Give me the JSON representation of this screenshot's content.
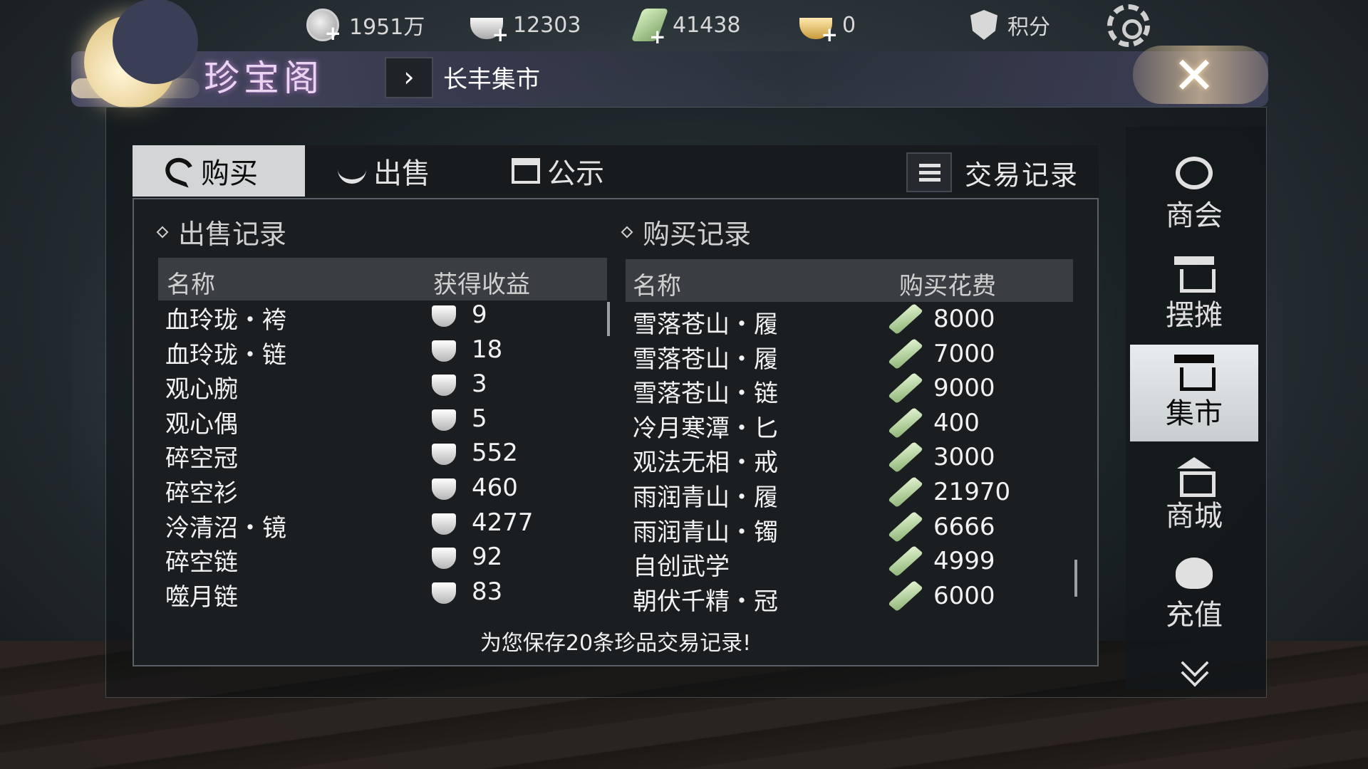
{
  "resources": [
    {
      "icon": "silver-coin-icon",
      "value": "1951万"
    },
    {
      "icon": "silver-ingot-icon",
      "value": "12303"
    },
    {
      "icon": "jade-icon",
      "value": "41438"
    },
    {
      "icon": "gold-ingot-icon",
      "value": "0"
    }
  ],
  "points_label": "积分",
  "title": "珍宝阁",
  "breadcrumb": "长丰集市",
  "tabs": [
    {
      "label": "购买",
      "active": true
    },
    {
      "label": "出售",
      "active": false
    },
    {
      "label": "公示",
      "active": false
    }
  ],
  "trade_record_label": "交易记录",
  "sell_records": {
    "title": "出售记录",
    "col_name": "名称",
    "col_value": "获得收益",
    "currency_icon": "silver-ingot-icon",
    "rows": [
      {
        "name": "血玲珑・袴",
        "value": "9"
      },
      {
        "name": "血玲珑・链",
        "value": "18"
      },
      {
        "name": "观心腕",
        "value": "3"
      },
      {
        "name": "观心偶",
        "value": "5"
      },
      {
        "name": "碎空冠",
        "value": "552"
      },
      {
        "name": "碎空衫",
        "value": "460"
      },
      {
        "name": "泠清沼・镜",
        "value": "4277"
      },
      {
        "name": "碎空链",
        "value": "92"
      },
      {
        "name": "噬月链",
        "value": "83"
      }
    ]
  },
  "buy_records": {
    "title": "购买记录",
    "col_name": "名称",
    "col_value": "购买花费",
    "currency_icon": "jade-icon",
    "rows": [
      {
        "name": "雪落苍山・履",
        "value": "8000"
      },
      {
        "name": "雪落苍山・履",
        "value": "7000"
      },
      {
        "name": "雪落苍山・链",
        "value": "9000"
      },
      {
        "name": "冷月寒潭・匕",
        "value": "400"
      },
      {
        "name": "观法无相・戒",
        "value": "3000"
      },
      {
        "name": "雨润青山・履",
        "value": "21970"
      },
      {
        "name": "雨润青山・镯",
        "value": "6666"
      },
      {
        "name": "自创武学",
        "value": "4999"
      },
      {
        "name": "朝伏千精・冠",
        "value": "6000"
      }
    ]
  },
  "footer_note": "为您保存20条珍品交易记录!",
  "side_nav": [
    {
      "label": "商会",
      "icon": "guild-icon",
      "active": false
    },
    {
      "label": "摆摊",
      "icon": "stall-icon",
      "active": false
    },
    {
      "label": "集市",
      "icon": "market-icon",
      "active": true
    },
    {
      "label": "商城",
      "icon": "mall-icon",
      "active": false
    },
    {
      "label": "充值",
      "icon": "recharge-icon",
      "active": false
    }
  ]
}
